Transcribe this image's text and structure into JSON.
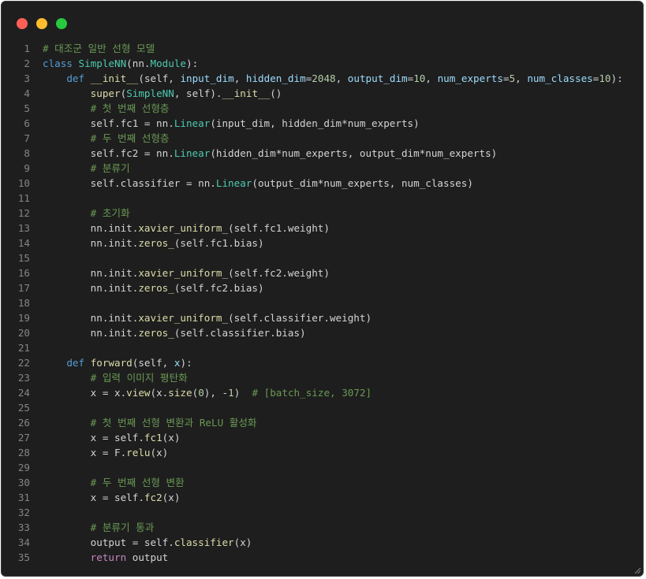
{
  "colors": {
    "background": "#1e1e1e",
    "line_number": "#858585",
    "default": "#d4d4d4",
    "keyword": "#569cd6",
    "function": "#dcdcaa",
    "class": "#4ec9b0",
    "parameter": "#9cdcfe",
    "number": "#b5cea8",
    "comment": "#6a9955",
    "control": "#c586c0",
    "dot_close": "#ff5f56",
    "dot_minimize": "#ffbd2e",
    "dot_maximize": "#27c93f"
  },
  "window_buttons": [
    "close",
    "minimize",
    "maximize"
  ],
  "code_lines": [
    {
      "n": "1",
      "tokens": [
        [
          "# 대조군 일반 선형 모델",
          "comment"
        ]
      ]
    },
    {
      "n": "2",
      "tokens": [
        [
          "class ",
          "keyword"
        ],
        [
          "SimpleNN",
          "class"
        ],
        [
          "(nn.",
          "default"
        ],
        [
          "Module",
          "class"
        ],
        [
          "):",
          "default"
        ]
      ]
    },
    {
      "n": "3",
      "tokens": [
        [
          "    ",
          "default"
        ],
        [
          "def ",
          "keyword"
        ],
        [
          "__init__",
          "function"
        ],
        [
          "(self, ",
          "default"
        ],
        [
          "input_dim",
          "parameter"
        ],
        [
          ", ",
          "default"
        ],
        [
          "hidden_dim",
          "parameter"
        ],
        [
          "=",
          "default"
        ],
        [
          "2048",
          "number"
        ],
        [
          ", ",
          "default"
        ],
        [
          "output_dim",
          "parameter"
        ],
        [
          "=",
          "default"
        ],
        [
          "10",
          "number"
        ],
        [
          ", ",
          "default"
        ],
        [
          "num_experts",
          "parameter"
        ],
        [
          "=",
          "default"
        ],
        [
          "5",
          "number"
        ],
        [
          ", ",
          "default"
        ],
        [
          "num_classes",
          "parameter"
        ],
        [
          "=",
          "default"
        ],
        [
          "10",
          "number"
        ],
        [
          "):",
          "default"
        ]
      ]
    },
    {
      "n": "4",
      "tokens": [
        [
          "        ",
          "default"
        ],
        [
          "super",
          "function"
        ],
        [
          "(",
          "default"
        ],
        [
          "SimpleNN",
          "class"
        ],
        [
          ", self).",
          "default"
        ],
        [
          "__init__",
          "function"
        ],
        [
          "()",
          "default"
        ]
      ]
    },
    {
      "n": "5",
      "tokens": [
        [
          "        ",
          "default"
        ],
        [
          "# 첫 번째 선형층",
          "comment"
        ]
      ]
    },
    {
      "n": "6",
      "tokens": [
        [
          "        self.fc1 = nn.",
          "default"
        ],
        [
          "Linear",
          "class"
        ],
        [
          "(input_dim, hidden_dim*num_experts)",
          "default"
        ]
      ]
    },
    {
      "n": "7",
      "tokens": [
        [
          "        ",
          "default"
        ],
        [
          "# 두 번째 선형층",
          "comment"
        ]
      ]
    },
    {
      "n": "8",
      "tokens": [
        [
          "        self.fc2 = nn.",
          "default"
        ],
        [
          "Linear",
          "class"
        ],
        [
          "(hidden_dim*num_experts, output_dim*num_experts)",
          "default"
        ]
      ]
    },
    {
      "n": "9",
      "tokens": [
        [
          "        ",
          "default"
        ],
        [
          "# 분류기",
          "comment"
        ]
      ]
    },
    {
      "n": "10",
      "tokens": [
        [
          "        self.classifier = nn.",
          "default"
        ],
        [
          "Linear",
          "class"
        ],
        [
          "(output_dim*num_experts, num_classes)",
          "default"
        ]
      ]
    },
    {
      "n": "11",
      "tokens": []
    },
    {
      "n": "12",
      "tokens": [
        [
          "        ",
          "default"
        ],
        [
          "# 초기화",
          "comment"
        ]
      ]
    },
    {
      "n": "13",
      "tokens": [
        [
          "        nn.init.",
          "default"
        ],
        [
          "xavier_uniform_",
          "function"
        ],
        [
          "(self.fc1.weight)",
          "default"
        ]
      ]
    },
    {
      "n": "14",
      "tokens": [
        [
          "        nn.init.",
          "default"
        ],
        [
          "zeros_",
          "function"
        ],
        [
          "(self.fc1.bias)",
          "default"
        ]
      ]
    },
    {
      "n": "15",
      "tokens": []
    },
    {
      "n": "16",
      "tokens": [
        [
          "        nn.init.",
          "default"
        ],
        [
          "xavier_uniform_",
          "function"
        ],
        [
          "(self.fc2.weight)",
          "default"
        ]
      ]
    },
    {
      "n": "17",
      "tokens": [
        [
          "        nn.init.",
          "default"
        ],
        [
          "zeros_",
          "function"
        ],
        [
          "(self.fc2.bias)",
          "default"
        ]
      ]
    },
    {
      "n": "18",
      "tokens": []
    },
    {
      "n": "19",
      "tokens": [
        [
          "        nn.init.",
          "default"
        ],
        [
          "xavier_uniform_",
          "function"
        ],
        [
          "(self.classifier.weight)",
          "default"
        ]
      ]
    },
    {
      "n": "20",
      "tokens": [
        [
          "        nn.init.",
          "default"
        ],
        [
          "zeros_",
          "function"
        ],
        [
          "(self.classifier.bias)",
          "default"
        ]
      ]
    },
    {
      "n": "21",
      "tokens": []
    },
    {
      "n": "22",
      "tokens": [
        [
          "    ",
          "default"
        ],
        [
          "def ",
          "keyword"
        ],
        [
          "forward",
          "function"
        ],
        [
          "(self, ",
          "default"
        ],
        [
          "x",
          "parameter"
        ],
        [
          "):",
          "default"
        ]
      ]
    },
    {
      "n": "23",
      "tokens": [
        [
          "        ",
          "default"
        ],
        [
          "# 입력 이미지 평탄화",
          "comment"
        ]
      ]
    },
    {
      "n": "24",
      "tokens": [
        [
          "        x = x.",
          "default"
        ],
        [
          "view",
          "function"
        ],
        [
          "(x.",
          "default"
        ],
        [
          "size",
          "function"
        ],
        [
          "(",
          "default"
        ],
        [
          "0",
          "number"
        ],
        [
          "), -",
          "default"
        ],
        [
          "1",
          "number"
        ],
        [
          ")  ",
          "default"
        ],
        [
          "# [batch_size, 3072]",
          "comment"
        ]
      ]
    },
    {
      "n": "25",
      "tokens": []
    },
    {
      "n": "26",
      "tokens": [
        [
          "        ",
          "default"
        ],
        [
          "# 첫 번째 선형 변환과 ReLU 활성화",
          "comment"
        ]
      ]
    },
    {
      "n": "27",
      "tokens": [
        [
          "        x = self.",
          "default"
        ],
        [
          "fc1",
          "function"
        ],
        [
          "(x)",
          "default"
        ]
      ]
    },
    {
      "n": "28",
      "tokens": [
        [
          "        x = F.",
          "default"
        ],
        [
          "relu",
          "function"
        ],
        [
          "(x)",
          "default"
        ]
      ]
    },
    {
      "n": "29",
      "tokens": []
    },
    {
      "n": "30",
      "tokens": [
        [
          "        ",
          "default"
        ],
        [
          "# 두 번째 선형 변환",
          "comment"
        ]
      ]
    },
    {
      "n": "31",
      "tokens": [
        [
          "        x = self.",
          "default"
        ],
        [
          "fc2",
          "function"
        ],
        [
          "(x)",
          "default"
        ]
      ]
    },
    {
      "n": "32",
      "tokens": []
    },
    {
      "n": "33",
      "tokens": [
        [
          "        ",
          "default"
        ],
        [
          "# 분류기 통과",
          "comment"
        ]
      ]
    },
    {
      "n": "34",
      "tokens": [
        [
          "        output = self.",
          "default"
        ],
        [
          "classifier",
          "function"
        ],
        [
          "(x)",
          "default"
        ]
      ]
    },
    {
      "n": "35",
      "tokens": [
        [
          "        ",
          "default"
        ],
        [
          "return ",
          "control"
        ],
        [
          "output",
          "default"
        ]
      ]
    }
  ]
}
